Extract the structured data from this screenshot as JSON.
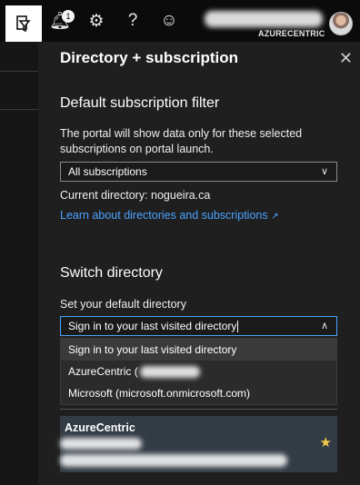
{
  "topbar": {
    "notifications_count": "1",
    "icons": [
      "directory-filter-icon",
      "bell-icon",
      "gear-icon",
      "help-icon",
      "smiley-icon"
    ],
    "account_tenant": "AZURECENTRIC"
  },
  "panel": {
    "title": "Directory + subscription",
    "default_sub_heading": "Default subscription filter",
    "description": "The portal will show data only for these selected subscriptions on portal launch.",
    "sub_select_value": "All subscriptions",
    "current_directory": "Current directory: nogueira.ca",
    "learn_link": "Learn about directories and subscriptions",
    "switch_heading": "Switch directory",
    "default_dir_label": "Set your default directory",
    "default_dir_value": "Sign in to your last visited directory",
    "dropdown_options": [
      "Sign in to your last visited directory",
      "AzureCentric (",
      "Microsoft (microsoft.onmicrosoft.com)"
    ],
    "directory_card_name": "AzureCentric"
  },
  "colors": {
    "accent_link": "#4aa3ff",
    "star": "#f2c94c",
    "panel_bg": "#1f1f1f"
  }
}
